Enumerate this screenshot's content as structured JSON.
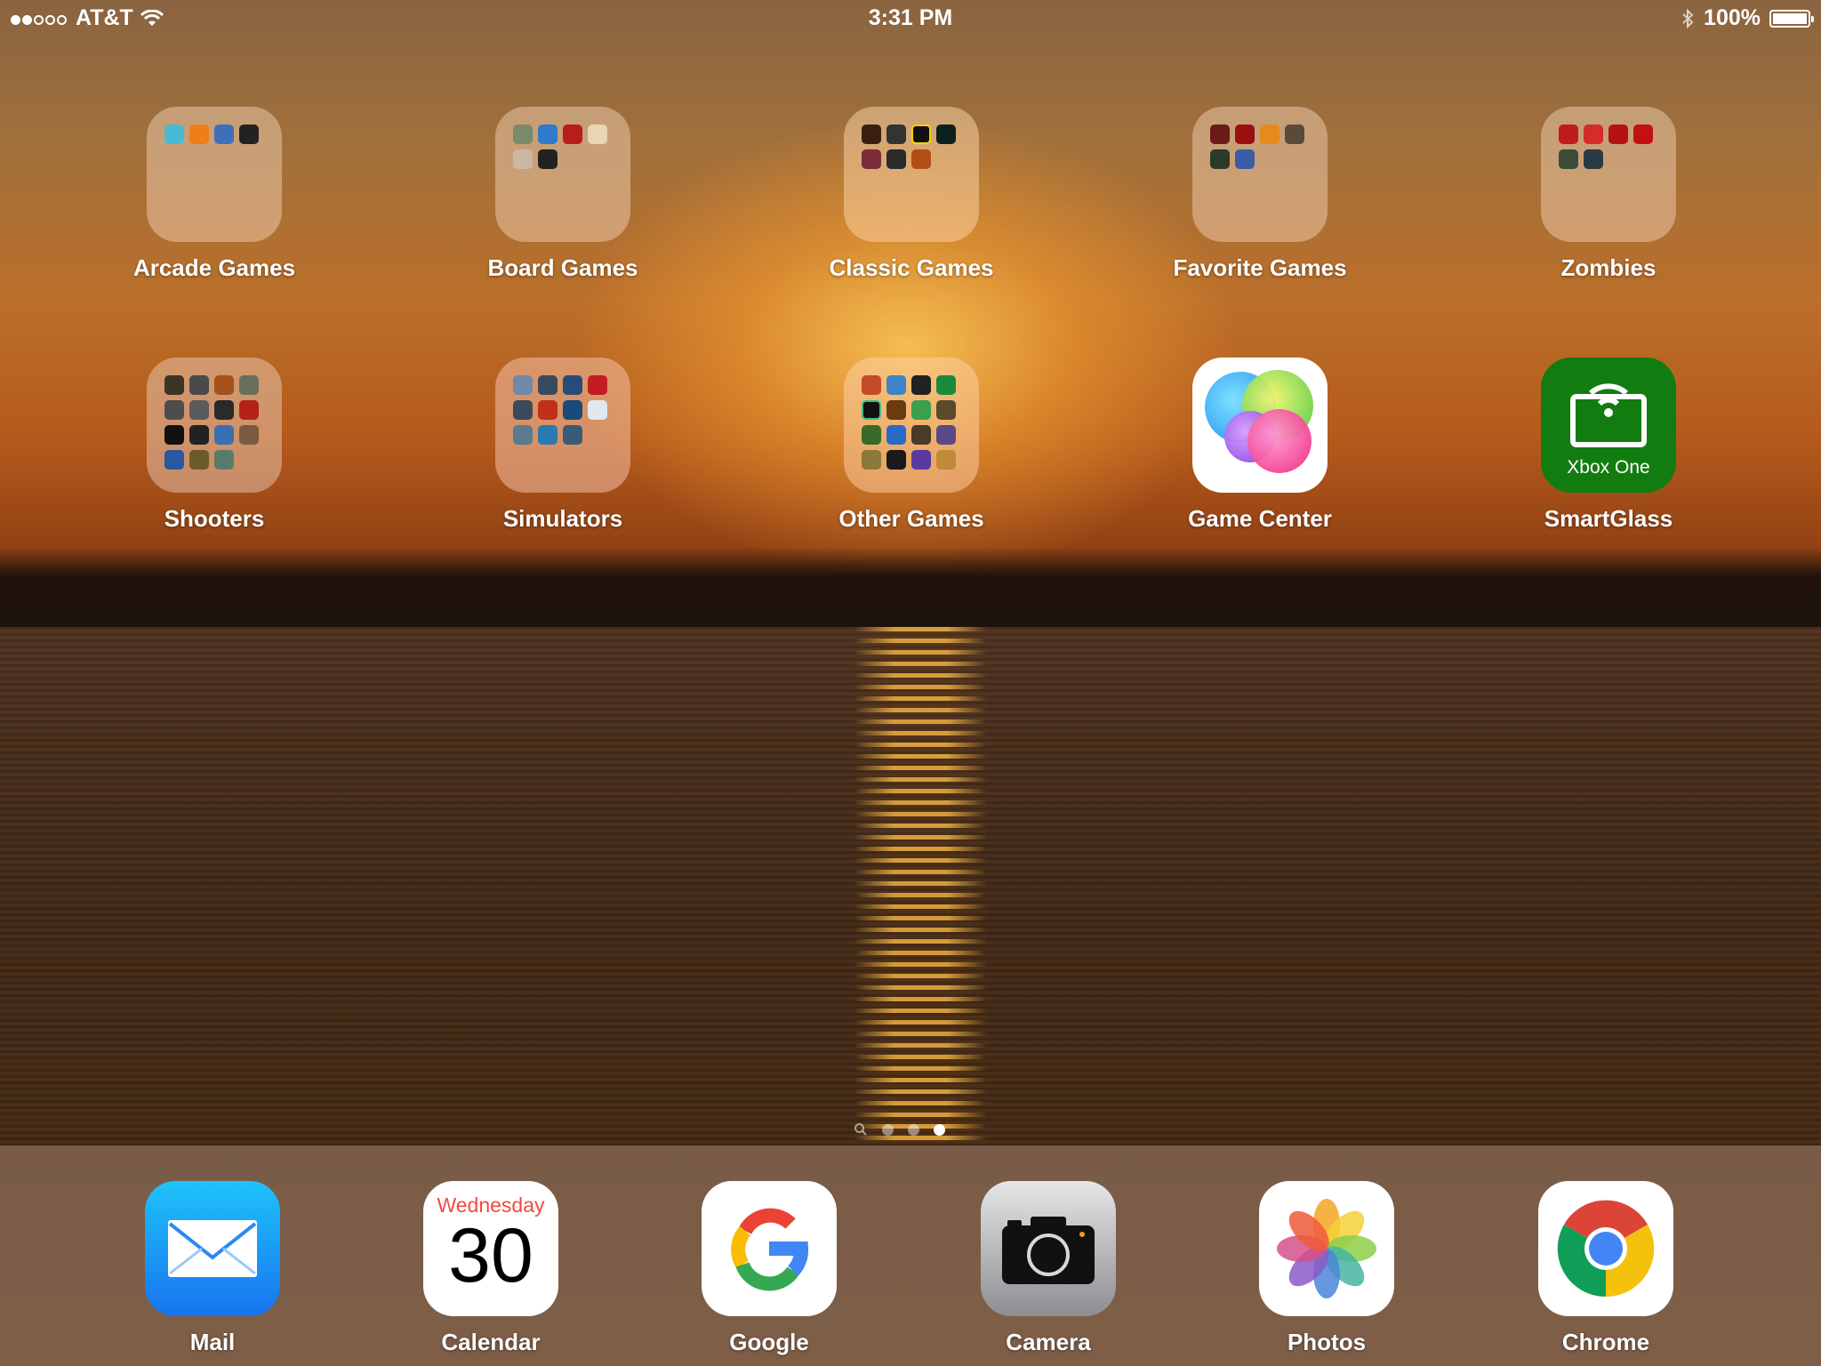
{
  "status_bar": {
    "carrier": "AT&T",
    "time": "3:31 PM",
    "battery": "100%"
  },
  "apps": {
    "arcade": "Arcade Games",
    "board": "Board Games",
    "classic": "Classic Games",
    "favorite": "Favorite Games",
    "zombies": "Zombies",
    "shooters": "Shooters",
    "simulators": "Simulators",
    "other": "Other Games",
    "gamecenter": "Game Center",
    "smartglass": "SmartGlass",
    "smartglass_icon_text": "Xbox One"
  },
  "dock": {
    "mail": "Mail",
    "calendar": "Calendar",
    "calendar_day": "Wednesday",
    "calendar_date": "30",
    "google": "Google",
    "camera": "Camera",
    "photos": "Photos",
    "chrome": "Chrome"
  },
  "page_indicator": {
    "pages": 3,
    "current": 3,
    "has_search_page": true
  },
  "colors": {
    "xbox_green": "#127c10",
    "mail_blue": "#1774f0",
    "calendar_red": "#f24b3e"
  }
}
